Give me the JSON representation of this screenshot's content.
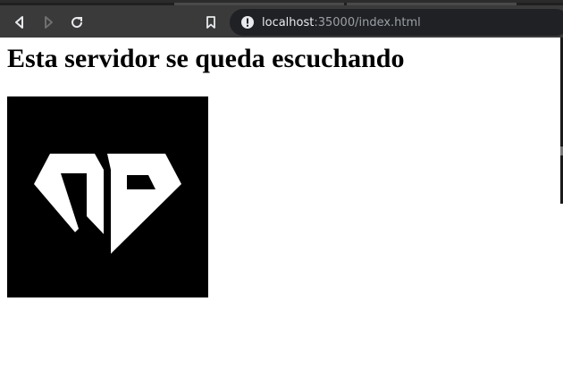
{
  "browser": {
    "url_host": "localhost",
    "url_rest": ":35000/index.html",
    "icons": {
      "back": "back-arrow-icon",
      "forward": "forward-arrow-icon",
      "reload": "reload-icon",
      "bookmark": "bookmark-icon",
      "site_info": "info-icon"
    },
    "colors": {
      "toolbar": "#3a3a3a",
      "address_bar": "#202124",
      "icon": "#e8eaed",
      "icon_disabled": "#6f6f6f"
    }
  },
  "page": {
    "heading": "Esta servidor se queda escuchando",
    "image": {
      "icon": "logo-image",
      "background": "#000000",
      "foreground": "#ffffff"
    }
  }
}
